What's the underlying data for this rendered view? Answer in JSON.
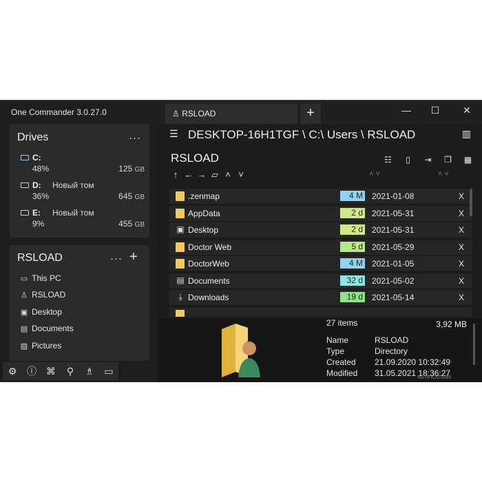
{
  "app": {
    "title": "One Commander 3.0.27.0"
  },
  "drives": {
    "title": "Drives",
    "menu": "···",
    "items": [
      {
        "letter": "C:",
        "name": "",
        "percent": "48%",
        "size": "125",
        "unit": "GB"
      },
      {
        "letter": "D:",
        "name": "Новый том",
        "percent": "36%",
        "size": "645",
        "unit": "GB"
      },
      {
        "letter": "E:",
        "name": "Новый том",
        "percent": "9%",
        "size": "455",
        "unit": "GB"
      }
    ]
  },
  "places": {
    "title": "RSLOAD",
    "menu": "···",
    "add": "+",
    "items": [
      {
        "label": "This PC",
        "icon": "monitor-icon"
      },
      {
        "label": "RSLOAD",
        "icon": "user-icon"
      },
      {
        "label": "Desktop",
        "icon": "desktop-icon"
      },
      {
        "label": "Documents",
        "icon": "documents-icon"
      },
      {
        "label": "Pictures",
        "icon": "pictures-icon"
      }
    ]
  },
  "tab": {
    "label": "RSLOAD",
    "add": "+"
  },
  "window_controls": {
    "minimize": "—",
    "maximize": "☐",
    "close": "✕"
  },
  "breadcrumb": {
    "text": "DESKTOP-16H1TGF \\ C:\\ Users \\ RSLOAD"
  },
  "folder": {
    "title": "RSLOAD"
  },
  "files": [
    {
      "name": ".zenmap",
      "age": "4 M",
      "age_color": "#8fd3ee",
      "date": "2021-01-08",
      "remove": "X",
      "icon": "folder-icon"
    },
    {
      "name": "AppData",
      "age": "2 d",
      "age_color": "#cfe98a",
      "date": "2021-05-31",
      "remove": "X",
      "icon": "folder-icon"
    },
    {
      "name": "Desktop",
      "age": "2 d",
      "age_color": "#cfe98a",
      "date": "2021-05-31",
      "remove": "X",
      "icon": "desktop-icon"
    },
    {
      "name": "Doctor Web",
      "age": "5 d",
      "age_color": "#b7e889",
      "date": "2021-05-29",
      "remove": "X",
      "icon": "folder-icon"
    },
    {
      "name": "DoctorWeb",
      "age": "4 M",
      "age_color": "#8fd3ee",
      "date": "2021-01-05",
      "remove": "X",
      "icon": "folder-icon"
    },
    {
      "name": "Documents",
      "age": "32 d",
      "age_color": "#8ce5e5",
      "date": "2021-05-02",
      "remove": "X",
      "icon": "documents-icon"
    },
    {
      "name": "Downloads",
      "age": "19 d",
      "age_color": "#8fe08f",
      "date": "2021-05-14",
      "remove": "X",
      "icon": "download-icon"
    }
  ],
  "info": {
    "items_count": "27 items",
    "total_size": "3,92 MB",
    "props": [
      {
        "label": "Name",
        "value": "RSLOAD"
      },
      {
        "label": "Type",
        "value": "Directory"
      },
      {
        "label": "Created",
        "value": "21.09.2020 10:32:49"
      },
      {
        "label": "Modified",
        "value": "31.05.2021 18:36:27"
      }
    ],
    "notification": "NOTIFICATIONS"
  }
}
